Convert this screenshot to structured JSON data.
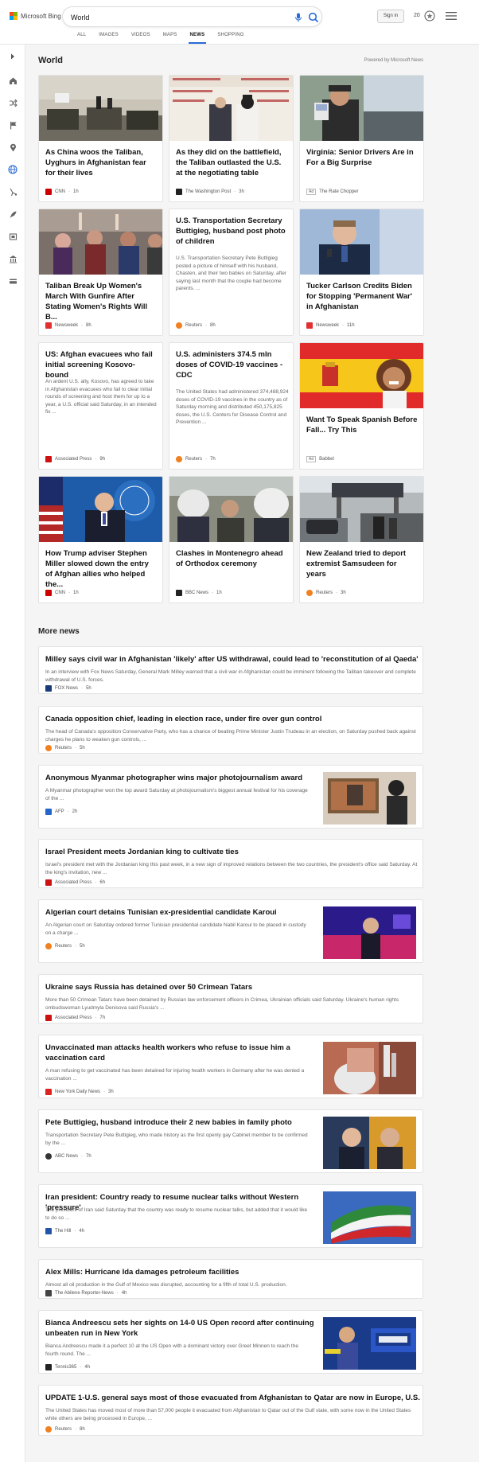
{
  "header": {
    "logo_text": "Microsoft Bing",
    "search_value": "World",
    "signin_label": "Sign in",
    "rewards_count": "20"
  },
  "tabs": [
    {
      "label": "ALL"
    },
    {
      "label": "IMAGES"
    },
    {
      "label": "VIDEOS"
    },
    {
      "label": "MAPS"
    },
    {
      "label": "NEWS",
      "active": true
    },
    {
      "label": "SHOPPING"
    }
  ],
  "sidebar_icons": [
    "collapse-arrow-icon",
    "home-icon",
    "shuffle-icon",
    "flag-icon",
    "location-icon",
    "globe-icon",
    "science-icon",
    "rocket-icon",
    "entertainment-icon",
    "finance-icon",
    "card-icon"
  ],
  "section": {
    "title": "World",
    "powered_by": "Powered by Microsoft News"
  },
  "cards": [
    {
      "title": "As China woos the Taliban, Uyghurs in Afghanistan fear for their lives",
      "source": "CNN",
      "time": "1h",
      "src_color": "#cc0000"
    },
    {
      "title": "As they did on the battlefield, the Taliban outlasted the U.S. at the negotiating table",
      "source": "The Washington Post",
      "time": "3h",
      "src_color": "#222222"
    },
    {
      "title": "Virginia: Senior Drivers Are in For a Big Surprise",
      "source": "The Rate Chopper",
      "ad": "Ad",
      "src_color": "#ffffff"
    },
    {
      "title": "Taliban Break Up Women's March With Gunfire After Stating Women's Rights Will B...",
      "source": "Newsweek",
      "time": "8h",
      "src_color": "#e03030"
    },
    {
      "title": "U.S. Transportation Secretary Buttigieg, husband post photo of children",
      "snippet": "U.S. Transportation Secretary Pete Buttigieg posted a picture of himself with his husband, Chasten, and their two babies on Saturday, after saying last month that the couple had become parents. ...",
      "source": "Reuters",
      "time": "8h",
      "src_color": "#f08020"
    },
    {
      "title": "Tucker Carlson Credits Biden for Stopping 'Permanent War' in Afghanistan",
      "source": "Newsweek",
      "time": "11h",
      "src_color": "#e03030"
    },
    {
      "title": "US: Afghan evacuees who fail initial screening Kosovo-bound",
      "snippet": "An ardent U.S. ally, Kosovo, has agreed to take in Afghanistan evacuees who fail to clear initial rounds of screening and host them for up to a year, a U.S. official said Saturday, in an intended fix ...",
      "source": "Associated Press",
      "time": "9h",
      "src_color": "#cc1111"
    },
    {
      "title": "U.S. administers 374.5 mln doses of COVID-19 vaccines - CDC",
      "snippet": "The United States had administered 374,488,924 doses of COVID-19 vaccines in the country as of Saturday morning and distributed 450,175,825 doses, the U.S. Centers for Disease Control and Prevention ...",
      "source": "Reuters",
      "time": "7h",
      "src_color": "#f08020"
    },
    {
      "title": "Want To Speak Spanish Before Fall... Try This",
      "source": "Babbel",
      "ad": "Ad",
      "src_color": "#ffffff"
    },
    {
      "title": "How Trump adviser Stephen Miller slowed down the entry of Afghan allies who helped the...",
      "source": "CNN",
      "time": "1h",
      "src_color": "#cc0000"
    },
    {
      "title": "Clashes in Montenegro ahead of Orthodox ceremony",
      "source": "BBC News",
      "time": "1h",
      "src_color": "#222222"
    },
    {
      "title": "New Zealand tried to deport extremist Samsudeen for years",
      "source": "Reuters",
      "time": "3h",
      "src_color": "#f08020"
    }
  ],
  "more_news": {
    "title": "More news",
    "items": [
      {
        "title": "Milley says civil war in Afghanistan 'likely' after US withdrawal, could lead to 'reconstitution of al Qaeda'",
        "snippet": "In an interview with Fox News Saturday, General Mark Milley warned that a civil war in Afghanistan could be imminent following the Taliban takeover and complete withdrawal of U.S. forces.",
        "source": "FOX News",
        "time": "5h",
        "src_color": "#1a3a7a"
      },
      {
        "title": "Canada opposition chief, leading in election race, under fire over gun control",
        "snippet": "The head of Canada's opposition Conservative Party, who has a chance of beating Prime Minister Justin Trudeau in an election, on Saturday pushed back against charges he plans to weaken gun controls, ...",
        "source": "Reuters",
        "time": "5h",
        "src_color": "#f08020"
      },
      {
        "title": "Anonymous Myanmar photographer wins major photojournalism award",
        "snippet": "A Myanmar photographer won the top award Saturday at photojournalism's biggest annual festival for his coverage of the ...",
        "source": "AFP",
        "time": "2h",
        "src_color": "#2266cc"
      },
      {
        "title": "Israel President meets Jordanian king to cultivate ties",
        "snippet": "Israel's president met with the Jordanian king this past week, in a new sign of improved relations between the two countries, the president's office said Saturday. At the king's invitation, new ...",
        "source": "Associated Press",
        "time": "6h",
        "src_color": "#cc1111"
      },
      {
        "title": "Algerian court detains Tunisian ex-presidential candidate Karoui",
        "snippet": "An Algerian court on Saturday ordered former Tunisian presidential candidate Nabil Karoui to be placed in custody on a charge ...",
        "source": "Reuters",
        "time": "5h",
        "src_color": "#f08020"
      },
      {
        "title": "Ukraine says Russia has detained over 50 Crimean Tatars",
        "snippet": "More than 50 Crimean Tatars have been detained by Russian law enforcement officers in Crimea, Ukrainian officials said Saturday. Ukraine's human rights ombudswoman Lyudmyla Denisova said Russia's ...",
        "source": "Associated Press",
        "time": "7h",
        "src_color": "#cc1111"
      },
      {
        "title": "Unvaccinated man attacks health workers who refuse to issue him a vaccination card",
        "snippet": "A man refusing to get vaccinated has been detained for injuring health workers in Germany after he was denied a vaccination ...",
        "source": "New York Daily News",
        "time": "3h",
        "src_color": "#dd2222"
      },
      {
        "title": "Pete Buttigieg, husband introduce their 2 new babies in family photo",
        "snippet": "Transportation Secretary Pete Buttigieg, who made history as the first openly gay Cabinet member to be confirmed by the ...",
        "source": "ABC News",
        "time": "7h",
        "src_color": "#333333"
      },
      {
        "title": "Iran president: Country ready to resume nuclear talks without Western 'pressure'",
        "snippet": "The president of Iran said Saturday that the country was ready to resume nuclear talks, but added that it would like to do so ...",
        "source": "The Hill",
        "time": "4h",
        "src_color": "#2255aa"
      },
      {
        "title": "Alex Mills: Hurricane Ida damages petroleum facilities",
        "snippet": "Almost all oil production in the Gulf of Mexico was disrupted, accounting for a fifth of total U.S. production.",
        "source": "The Abilene Reporter-News",
        "time": "4h",
        "src_color": "#444444"
      },
      {
        "title": "Bianca Andreescu sets her sights on 14-0 US Open record after continuing unbeaten run in New York",
        "snippet": "Bianca Andreescu made it a perfect 10 at the US Open with a dominant victory over Greet Minnen to reach the fourth round. The ...",
        "source": "Tennis365",
        "time": "4h",
        "src_color": "#222222"
      },
      {
        "title": "UPDATE 1-U.S. general says most of those evacuated from Afghanistan to Qatar are now in Europe, U.S.",
        "snippet": "The United States has moved most of more than 57,000 people it evacuated from Afghanistan to Qatar out of the Gulf state, with some now in the United States while others are being processed in Europe, ...",
        "source": "Reuters",
        "time": "8h",
        "src_color": "#f08020"
      }
    ]
  }
}
